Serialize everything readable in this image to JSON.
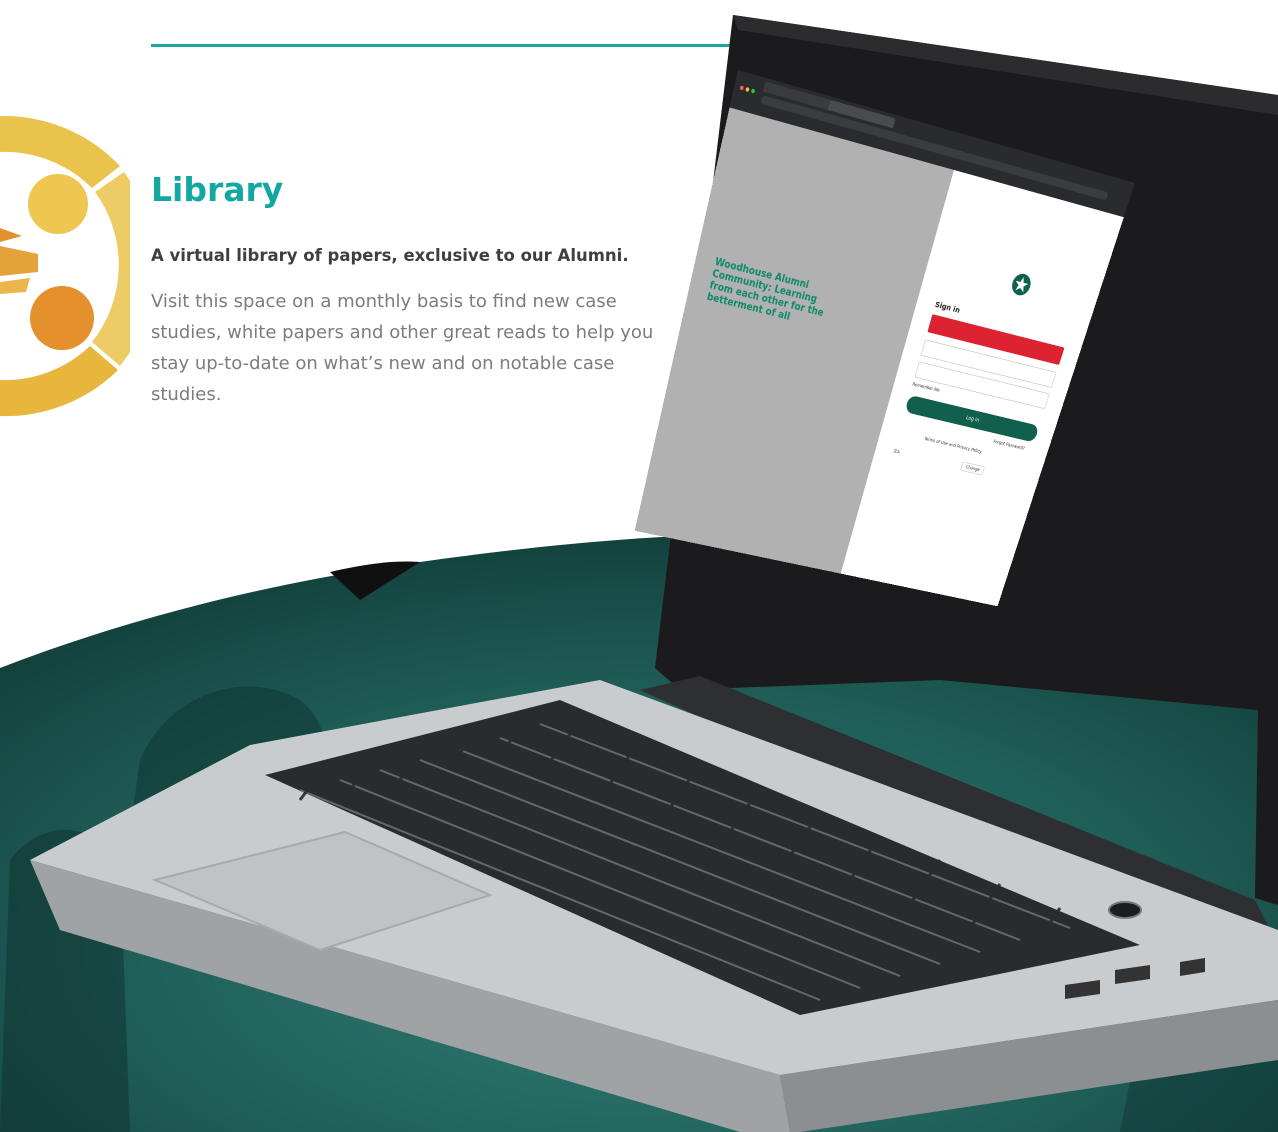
{
  "section": {
    "title": "Library",
    "subtitle": "A virtual library of papers, exclusive to our Alumni.",
    "body": "Visit this space on a monthly basis to find new case studies, white papers and other great reads to help you stay up-to-date on  what’s new and on notable case studies."
  },
  "colors": {
    "accent": "#13a7a1",
    "teal_photo": "#1f5d57",
    "logo_yellow": "#eac24a",
    "logo_orange": "#e4902d",
    "login_button": "#11604e",
    "alert_red": "#dd2331"
  },
  "laptop_screen": {
    "tagline": "Woodhouse Alumni Community: Learning from each other for the betterment of all",
    "signin": {
      "heading": "Sign in",
      "remember_label": "Remember Me",
      "login_button": "Log in",
      "forgot_link": "Forgot Password?",
      "terms_link": "Terms of Use and Privacy Policy",
      "change_button": "Change"
    }
  },
  "icons": [
    "logo-mark",
    "laptop",
    "star-logo-icon",
    "language-icon"
  ]
}
